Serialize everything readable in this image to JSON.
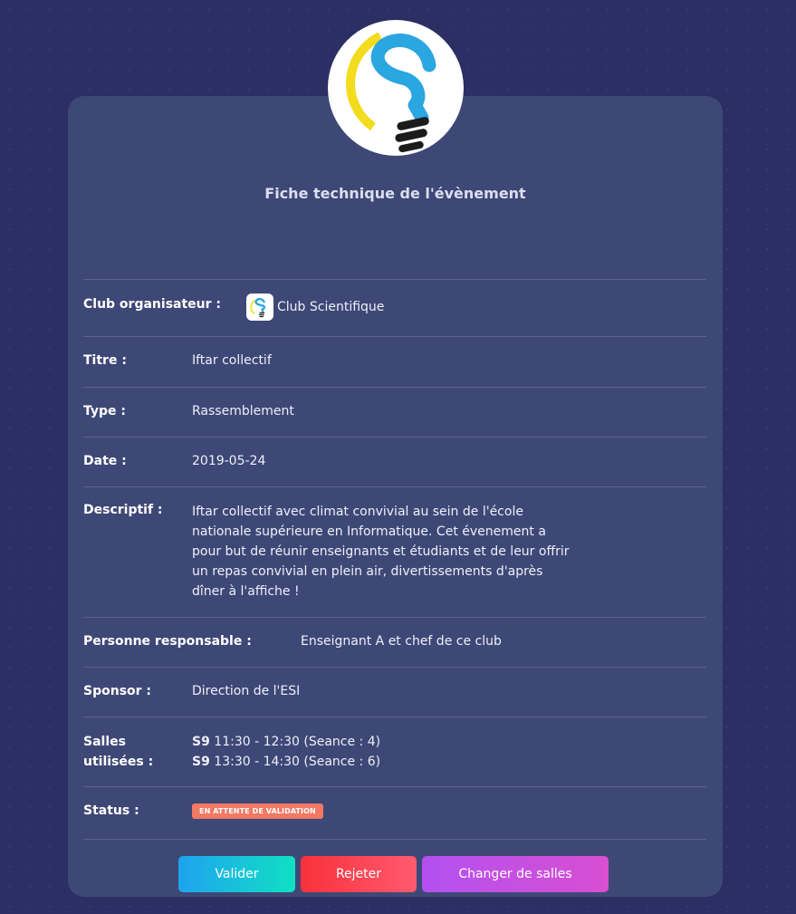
{
  "header": {
    "title": "Fiche technique de l'évènement"
  },
  "fields": {
    "club_label": "Club organisateur :",
    "club_value": "Club Scientifique",
    "title_label": "Titre :",
    "title_value": "Iftar collectif",
    "type_label": "Type :",
    "type_value": "Rassemblement",
    "date_label": "Date :",
    "date_value": "2019-05-24",
    "desc_label": "Descriptif :",
    "desc_lines": [
      "Iftar collectif avec climat convivial au sein de l'école",
      "nationale supérieure en Informatique. Cet évenement a",
      "pour but de réunir enseignants et étudiants et de leur offrir",
      "un repas convivial en plein air, divertissements d'après",
      "dîner à l'affiche !"
    ],
    "responsible_label": "Personne responsable :",
    "responsible_value": "Enseignant A et chef de ce club",
    "sponsor_label": "Sponsor :",
    "sponsor_value": "Direction de l'ESI",
    "rooms_label_1": "Salles",
    "rooms_label_2": "utilisées :",
    "rooms": [
      {
        "room": "S9",
        "detail": "11:30 - 12:30 (Seance : 4)"
      },
      {
        "room": "S9",
        "detail": "13:30 - 14:30 (Seance : 6)"
      }
    ],
    "status_label": "Status :",
    "status_value": "EN ATTENTE DE VALIDATION"
  },
  "actions": {
    "validate": "Valider",
    "reject": "Rejeter",
    "change_rooms": "Changer de salles"
  },
  "colors": {
    "background": "#2c2f63",
    "card": "#3e4876",
    "badge": "#f27963",
    "logo_blue": "#2aa6e0",
    "logo_yellow": "#f2dc1d"
  },
  "icons": {
    "logo": "lightbulb-s-logo"
  }
}
